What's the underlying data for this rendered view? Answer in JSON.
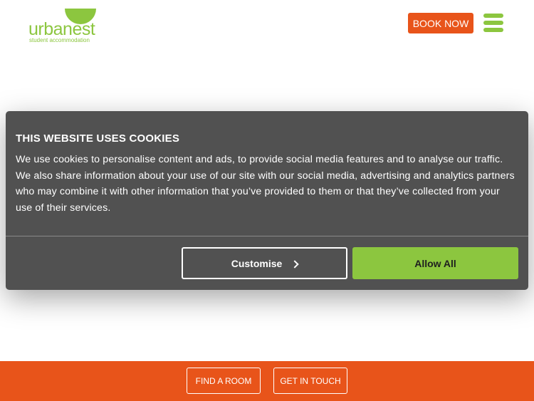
{
  "header": {
    "logo": {
      "word": "urbanest",
      "tagline": "student accommodation"
    },
    "book_now_label": "BOOK NOW",
    "menu_icon": "hamburger-menu-icon"
  },
  "cookie_banner": {
    "title": "THIS WEBSITE USES COOKIES",
    "body": "We use cookies to personalise content and ads, to provide social media features and to analyse our traffic. We also share information about your use of our site with our social media, advertising and analytics partners who may combine it with other information that you’ve provided to them or that they’ve collected from your use of their services.",
    "customise_label": "Customise",
    "allow_all_label": "Allow All"
  },
  "footer": {
    "find_room_label": "FIND A ROOM",
    "get_in_touch_label": "GET IN TOUCH"
  },
  "colors": {
    "brand_green": "#8cc63f",
    "brand_orange": "#e8541a",
    "banner_bg": "#515151"
  }
}
